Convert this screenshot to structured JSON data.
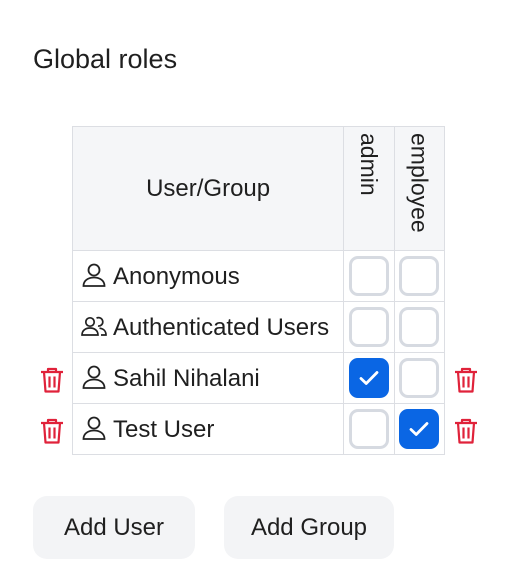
{
  "title": "Global roles",
  "table": {
    "user_header": "User/Group",
    "roles": [
      "admin",
      "employee"
    ],
    "rows": [
      {
        "name": "Anonymous",
        "icon": "user-icon",
        "checks": [
          false,
          false
        ],
        "deletable": false
      },
      {
        "name": "Authenticated Users",
        "icon": "group-icon",
        "checks": [
          false,
          false
        ],
        "deletable": false
      },
      {
        "name": "Sahil Nihalani",
        "icon": "user-icon",
        "checks": [
          true,
          false
        ],
        "deletable": true
      },
      {
        "name": "Test User",
        "icon": "user-icon",
        "checks": [
          false,
          true
        ],
        "deletable": true
      }
    ]
  },
  "buttons": {
    "add_user": "Add User",
    "add_group": "Add Group"
  },
  "colors": {
    "accent": "#0a66e4",
    "danger": "#e0223a",
    "checkbox_border": "#d6dae1",
    "header_bg": "#f5f6f8",
    "button_bg": "#f3f4f6"
  }
}
